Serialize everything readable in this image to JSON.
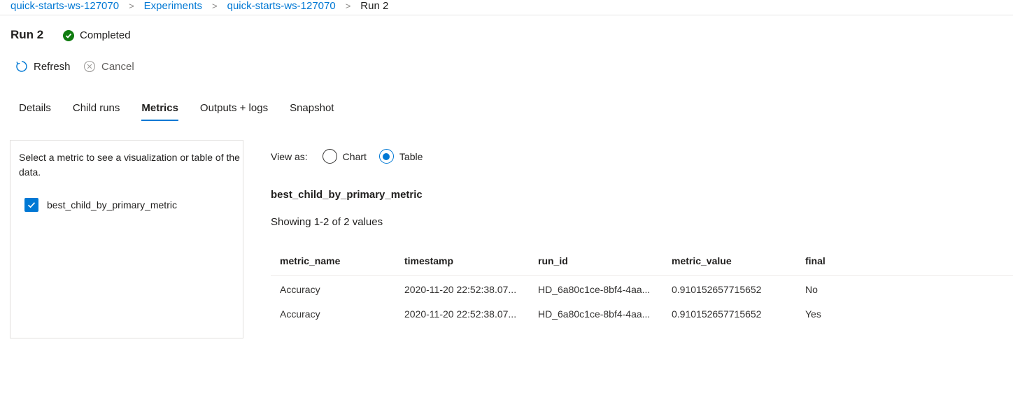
{
  "breadcrumb": {
    "items": [
      "quick-starts-ws-127070",
      "Experiments",
      "quick-starts-ws-127070"
    ],
    "current": "Run 2"
  },
  "header": {
    "title": "Run 2",
    "status": "Completed"
  },
  "commands": {
    "refresh": "Refresh",
    "cancel": "Cancel"
  },
  "tabs": [
    "Details",
    "Child runs",
    "Metrics",
    "Outputs + logs",
    "Snapshot"
  ],
  "active_tab": "Metrics",
  "metrics_panel": {
    "hint": "Select a metric to see a visualization or table of the data.",
    "metric": "best_child_by_primary_metric"
  },
  "view": {
    "label": "View as:",
    "chart": "Chart",
    "table": "Table",
    "selected": "Table"
  },
  "table_section": {
    "title": "best_child_by_primary_metric",
    "showing": "Showing 1-2 of 2 values",
    "columns": [
      "metric_name",
      "timestamp",
      "run_id",
      "metric_value",
      "final"
    ],
    "rows": [
      [
        "Accuracy",
        "2020-11-20 22:52:38.07...",
        "HD_6a80c1ce-8bf4-4aa...",
        "0.910152657715652",
        "No"
      ],
      [
        "Accuracy",
        "2020-11-20 22:52:38.07...",
        "HD_6a80c1ce-8bf4-4aa...",
        "0.910152657715652",
        "Yes"
      ]
    ]
  },
  "colors": {
    "accent": "#0078d4",
    "success": "#107c10"
  }
}
